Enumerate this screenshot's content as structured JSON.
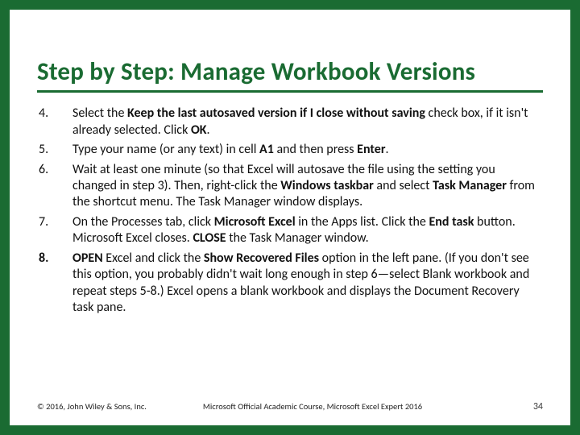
{
  "title": "Step by Step: Manage Workbook Versions",
  "steps": [
    {
      "num": "4.",
      "num_bold": false,
      "segments": [
        {
          "t": "Select the ",
          "b": false
        },
        {
          "t": "Keep the last autosaved version if I close without saving",
          "b": true
        },
        {
          "t": " check box, if it isn't already selected. Click ",
          "b": false
        },
        {
          "t": "OK",
          "b": true
        },
        {
          "t": ".",
          "b": false
        }
      ]
    },
    {
      "num": "5.",
      "num_bold": false,
      "segments": [
        {
          "t": "Type your name (or any text) in cell ",
          "b": false
        },
        {
          "t": "A1",
          "b": true
        },
        {
          "t": " and then press ",
          "b": false
        },
        {
          "t": "Enter",
          "b": true
        },
        {
          "t": ".",
          "b": false
        }
      ]
    },
    {
      "num": "6.",
      "num_bold": false,
      "segments": [
        {
          "t": "Wait at least one minute (so that Excel will autosave the file using the setting you changed in step 3). Then, right-click the ",
          "b": false
        },
        {
          "t": "Windows taskbar",
          "b": true
        },
        {
          "t": " and select ",
          "b": false
        },
        {
          "t": "Task Manager",
          "b": true
        },
        {
          "t": " from the shortcut menu. The Task Manager window displays.",
          "b": false
        }
      ]
    },
    {
      "num": "7.",
      "num_bold": false,
      "segments": [
        {
          "t": "On the Processes tab, click ",
          "b": false
        },
        {
          "t": "Microsoft Excel",
          "b": true
        },
        {
          "t": " in the Apps list. Click the ",
          "b": false
        },
        {
          "t": "End task",
          "b": true
        },
        {
          "t": " button. Microsoft Excel closes. ",
          "b": false
        },
        {
          "t": "CLOSE",
          "b": true
        },
        {
          "t": " the Task Manager window.",
          "b": false
        }
      ]
    },
    {
      "num": "8.",
      "num_bold": true,
      "segments": [
        {
          "t": "OPEN",
          "b": true
        },
        {
          "t": " Excel and click the ",
          "b": false
        },
        {
          "t": "Show Recovered Files",
          "b": true
        },
        {
          "t": " option in the left pane. (If you don't see this option, you probably didn't wait long enough in step 6—select Blank workbook and repeat steps 5-8.) Excel opens a blank workbook and displays the Document Recovery task pane.",
          "b": false
        }
      ]
    }
  ],
  "footer": {
    "copyright": "© 2016, John Wiley & Sons, Inc.",
    "course": "Microsoft Official Academic Course, Microsoft Excel Expert 2016",
    "page": "34"
  }
}
